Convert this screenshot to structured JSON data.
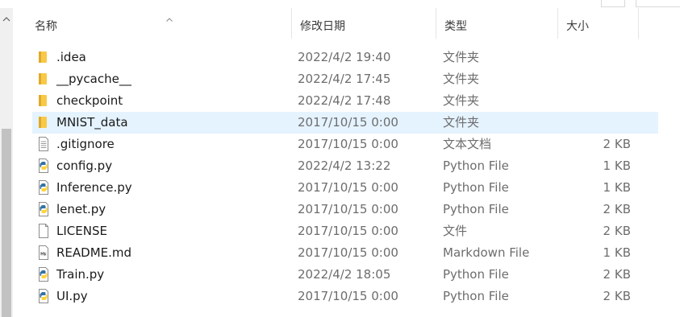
{
  "columns": {
    "name": "名称",
    "modified": "修改日期",
    "type": "类型",
    "size": "大小"
  },
  "files": [
    {
      "name": ".idea",
      "modified": "2022/4/2 19:40",
      "type": "文件夹",
      "size": "",
      "icon": "folder-icon"
    },
    {
      "name": "__pycache__",
      "modified": "2022/4/2 17:45",
      "type": "文件夹",
      "size": "",
      "icon": "folder-icon"
    },
    {
      "name": "checkpoint",
      "modified": "2022/4/2 17:48",
      "type": "文件夹",
      "size": "",
      "icon": "folder-icon"
    },
    {
      "name": "MNIST_data",
      "modified": "2017/10/15 0:00",
      "type": "文件夹",
      "size": "",
      "icon": "folder-icon",
      "selected": true
    },
    {
      "name": ".gitignore",
      "modified": "2017/10/15 0:00",
      "type": "文本文档",
      "size": "2 KB",
      "icon": "text-file-icon"
    },
    {
      "name": "config.py",
      "modified": "2022/4/2 13:22",
      "type": "Python File",
      "size": "1 KB",
      "icon": "python-file-icon"
    },
    {
      "name": "Inference.py",
      "modified": "2017/10/15 0:00",
      "type": "Python File",
      "size": "1 KB",
      "icon": "python-file-icon"
    },
    {
      "name": "lenet.py",
      "modified": "2017/10/15 0:00",
      "type": "Python File",
      "size": "2 KB",
      "icon": "python-file-icon"
    },
    {
      "name": "LICENSE",
      "modified": "2017/10/15 0:00",
      "type": "文件",
      "size": "2 KB",
      "icon": "blank-file-icon"
    },
    {
      "name": "README.md",
      "modified": "2017/10/15 0:00",
      "type": "Markdown File",
      "size": "1 KB",
      "icon": "markdown-file-icon"
    },
    {
      "name": "Train.py",
      "modified": "2022/4/2 18:05",
      "type": "Python File",
      "size": "2 KB",
      "icon": "python-file-icon"
    },
    {
      "name": "UI.py",
      "modified": "2017/10/15 0:00",
      "type": "Python File",
      "size": "2 KB",
      "icon": "python-file-icon"
    }
  ],
  "colors": {
    "selection": "#e5f3ff",
    "folder": "#f8c948",
    "python_blue": "#3572a5",
    "python_yellow": "#ffd43b"
  }
}
